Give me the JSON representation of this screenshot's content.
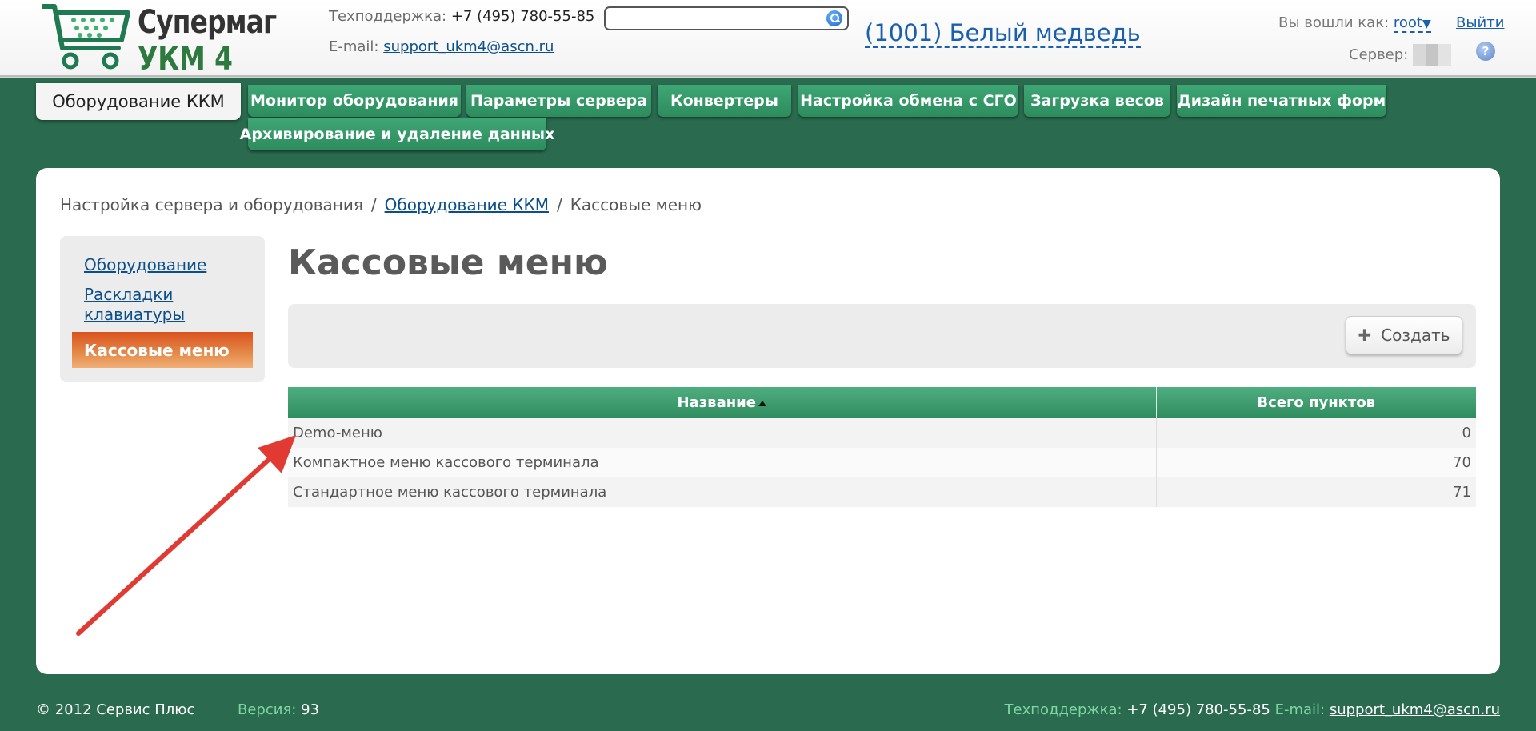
{
  "header": {
    "logo_line1": "Супермаг",
    "logo_line2": "УКМ 4",
    "support_label": "Техподдержка:",
    "support_phone": "+7 (495) 780-55-85",
    "email_label": "E-mail:",
    "email": "support_ukm4@ascn.ru",
    "search_value": "",
    "store_name": "(1001) Белый медведь",
    "user_label": "Вы вошли как:",
    "user_name": "root",
    "user_caret": "▼",
    "logout": "Выйти",
    "server_label": "Сервер:",
    "help": "?"
  },
  "nav": {
    "active": "Оборудование ККМ",
    "tabs": [
      "Монитор оборудования",
      "Параметры сервера",
      "Конвертеры",
      "Настройка обмена с СГО",
      "Загрузка весов",
      "Дизайн печатных форм",
      "Архивирование и удаление данных"
    ]
  },
  "breadcrumb": {
    "items": [
      "Настройка сервера и оборудования",
      "Оборудование ККМ",
      "Кассовые меню"
    ],
    "separator": "/"
  },
  "sidebar": {
    "items": [
      "Оборудование",
      "Раскладки клавиатуры",
      "Кассовые меню"
    ]
  },
  "page": {
    "title": "Кассовые меню",
    "create_label": "Создать",
    "create_icon": "plus-icon"
  },
  "table": {
    "columns": [
      "Название",
      "Всего пунктов"
    ],
    "rows": [
      {
        "name": "Demo-меню",
        "count": "0"
      },
      {
        "name": "Компактное меню кассового терминала",
        "count": "70"
      },
      {
        "name": "Стандартное меню кассового терминала",
        "count": "71"
      }
    ]
  },
  "footer": {
    "copyright": "© 2012 Сервис Плюс",
    "version_label": "Версия:",
    "version": "93",
    "support_label": "Техподдержка:",
    "support_phone": "+7 (495) 780-55-85",
    "email_label": "E-mail:",
    "email": "support_ukm4@ascn.ru"
  },
  "colors": {
    "background": "#2a6a4e",
    "tab_green": "#34966a",
    "active_menu_orange": "#e06a2e",
    "link_blue": "#0b4f8a",
    "annotation_red": "#e03a32"
  }
}
